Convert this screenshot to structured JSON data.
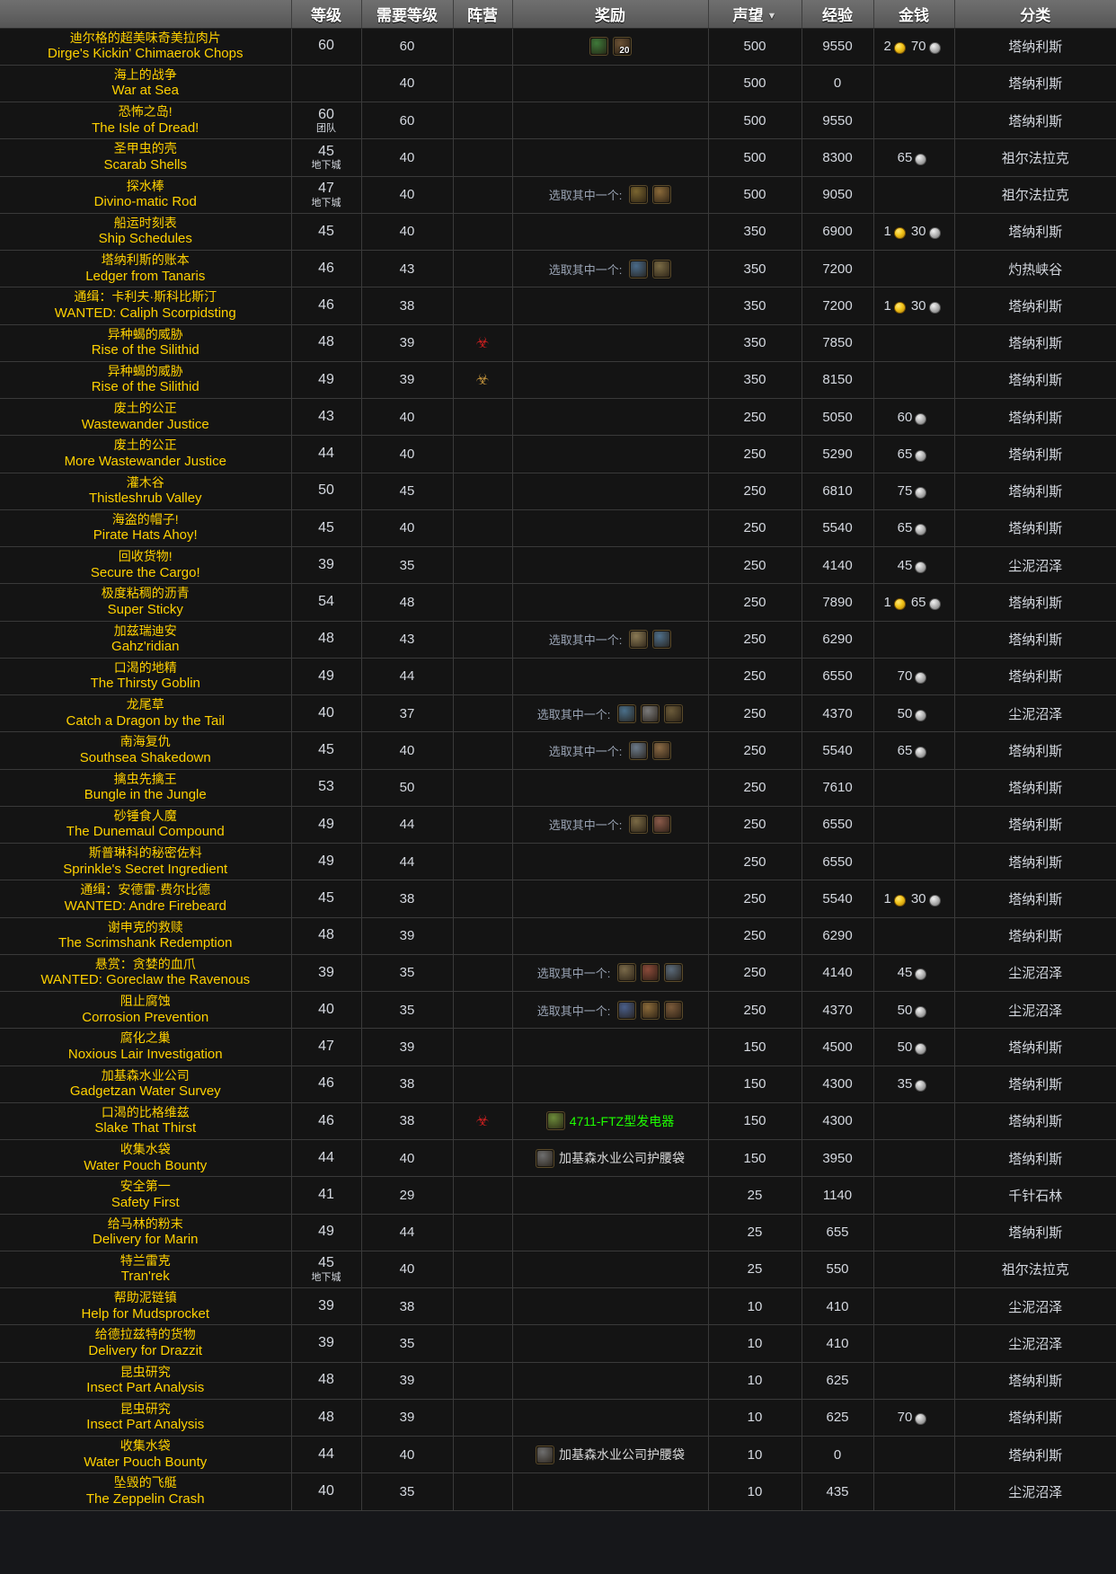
{
  "table": {
    "columns": [
      {
        "key": "name",
        "label": ""
      },
      {
        "key": "level",
        "label": "等级"
      },
      {
        "key": "req",
        "label": "需要等级"
      },
      {
        "key": "faction",
        "label": "阵营"
      },
      {
        "key": "reward",
        "label": "奖励"
      },
      {
        "key": "rep",
        "label": "声望",
        "sorted": "desc",
        "sort_icon": "▼"
      },
      {
        "key": "xp",
        "label": "经验"
      },
      {
        "key": "money",
        "label": "金钱"
      },
      {
        "key": "cat",
        "label": "分类"
      }
    ],
    "choose_one_label": "选取其中一个:",
    "level_tags": {
      "raid": "团队",
      "dungeon": "地下城"
    },
    "rows": [
      {
        "cn": "迪尔格的超美味奇美拉肉片",
        "en": "Dirge's Kickin' Chimaerok Chops",
        "level": "60",
        "level_tag": "",
        "req": "60",
        "faction": "",
        "reward_label": "",
        "reward_icons": [
          {
            "color": "#3f7a3a",
            "stack": ""
          },
          {
            "color": "#6b5235",
            "stack": "20"
          }
        ],
        "reward_text": "",
        "reward_text_color": "",
        "rep": "500",
        "xp": "9550",
        "gold": "2",
        "silver": "70",
        "cat": "塔纳利斯"
      },
      {
        "cn": "海上的战争",
        "en": "War at Sea",
        "level": "",
        "level_tag": "",
        "req": "40",
        "faction": "",
        "reward_label": "",
        "reward_icons": [],
        "reward_text": "",
        "reward_text_color": "",
        "rep": "500",
        "xp": "0",
        "gold": "",
        "silver": "",
        "cat": "塔纳利斯"
      },
      {
        "cn": "恐怖之岛!",
        "en": "The Isle of Dread!",
        "level": "60",
        "level_tag": "团队",
        "req": "60",
        "faction": "",
        "reward_label": "",
        "reward_icons": [],
        "reward_text": "",
        "reward_text_color": "",
        "rep": "500",
        "xp": "9550",
        "gold": "",
        "silver": "",
        "cat": "塔纳利斯"
      },
      {
        "cn": "圣甲虫的壳",
        "en": "Scarab Shells",
        "level": "45",
        "level_tag": "地下城",
        "req": "40",
        "faction": "",
        "reward_label": "",
        "reward_icons": [],
        "reward_text": "",
        "reward_text_color": "",
        "rep": "500",
        "xp": "8300",
        "gold": "",
        "silver": "65",
        "cat": "祖尔法拉克"
      },
      {
        "cn": "探水棒",
        "en": "Divino-matic Rod",
        "level": "47",
        "level_tag": "地下城",
        "req": "40",
        "faction": "",
        "reward_label": "选取其中一个:",
        "reward_icons": [
          {
            "color": "#7a6530",
            "stack": ""
          },
          {
            "color": "#8a6a3a",
            "stack": ""
          }
        ],
        "reward_text": "",
        "reward_text_color": "",
        "rep": "500",
        "xp": "9050",
        "gold": "",
        "silver": "",
        "cat": "祖尔法拉克"
      },
      {
        "cn": "船运时刻表",
        "en": "Ship Schedules",
        "level": "45",
        "level_tag": "",
        "req": "40",
        "faction": "",
        "reward_label": "",
        "reward_icons": [],
        "reward_text": "",
        "reward_text_color": "",
        "rep": "350",
        "xp": "6900",
        "gold": "1",
        "silver": "30",
        "cat": "塔纳利斯"
      },
      {
        "cn": "塔纳利斯的账本",
        "en": "Ledger from Tanaris",
        "level": "46",
        "level_tag": "",
        "req": "43",
        "faction": "",
        "reward_label": "选取其中一个:",
        "reward_icons": [
          {
            "color": "#4a6b8a",
            "stack": ""
          },
          {
            "color": "#7a6b45",
            "stack": ""
          }
        ],
        "reward_text": "",
        "reward_text_color": "",
        "rep": "350",
        "xp": "7200",
        "gold": "",
        "silver": "",
        "cat": "灼热峡谷"
      },
      {
        "cn": "通缉：卡利夫·斯科比斯汀",
        "en": "WANTED: Caliph Scorpidsting",
        "level": "46",
        "level_tag": "",
        "req": "38",
        "faction": "",
        "reward_label": "",
        "reward_icons": [],
        "reward_text": "",
        "reward_text_color": "",
        "rep": "350",
        "xp": "7200",
        "gold": "1",
        "silver": "30",
        "cat": "塔纳利斯"
      },
      {
        "cn": "异种蝎的威胁",
        "en": "Rise of the Silithid",
        "level": "48",
        "level_tag": "",
        "req": "39",
        "faction": "horde",
        "reward_label": "",
        "reward_icons": [],
        "reward_text": "",
        "reward_text_color": "",
        "rep": "350",
        "xp": "7850",
        "gold": "",
        "silver": "",
        "cat": "塔纳利斯"
      },
      {
        "cn": "异种蝎的威胁",
        "en": "Rise of the Silithid",
        "level": "49",
        "level_tag": "",
        "req": "39",
        "faction": "alliance",
        "reward_label": "",
        "reward_icons": [],
        "reward_text": "",
        "reward_text_color": "",
        "rep": "350",
        "xp": "8150",
        "gold": "",
        "silver": "",
        "cat": "塔纳利斯"
      },
      {
        "cn": "废土的公正",
        "en": "Wastewander Justice",
        "level": "43",
        "level_tag": "",
        "req": "40",
        "faction": "",
        "reward_label": "",
        "reward_icons": [],
        "reward_text": "",
        "reward_text_color": "",
        "rep": "250",
        "xp": "5050",
        "gold": "",
        "silver": "60",
        "cat": "塔纳利斯"
      },
      {
        "cn": "废土的公正",
        "en": "More Wastewander Justice",
        "level": "44",
        "level_tag": "",
        "req": "40",
        "faction": "",
        "reward_label": "",
        "reward_icons": [],
        "reward_text": "",
        "reward_text_color": "",
        "rep": "250",
        "xp": "5290",
        "gold": "",
        "silver": "65",
        "cat": "塔纳利斯"
      },
      {
        "cn": "灌木谷",
        "en": "Thistleshrub Valley",
        "level": "50",
        "level_tag": "",
        "req": "45",
        "faction": "",
        "reward_label": "",
        "reward_icons": [],
        "reward_text": "",
        "reward_text_color": "",
        "rep": "250",
        "xp": "6810",
        "gold": "",
        "silver": "75",
        "cat": "塔纳利斯"
      },
      {
        "cn": "海盗的帽子!",
        "en": "Pirate Hats Ahoy!",
        "level": "45",
        "level_tag": "",
        "req": "40",
        "faction": "",
        "reward_label": "",
        "reward_icons": [],
        "reward_text": "",
        "reward_text_color": "",
        "rep": "250",
        "xp": "5540",
        "gold": "",
        "silver": "65",
        "cat": "塔纳利斯"
      },
      {
        "cn": "回收货物!",
        "en": "Secure the Cargo!",
        "level": "39",
        "level_tag": "",
        "req": "35",
        "faction": "",
        "reward_label": "",
        "reward_icons": [],
        "reward_text": "",
        "reward_text_color": "",
        "rep": "250",
        "xp": "4140",
        "gold": "",
        "silver": "45",
        "cat": "尘泥沼泽"
      },
      {
        "cn": "极度粘稠的沥青",
        "en": "Super Sticky",
        "level": "54",
        "level_tag": "",
        "req": "48",
        "faction": "",
        "reward_label": "",
        "reward_icons": [],
        "reward_text": "",
        "reward_text_color": "",
        "rep": "250",
        "xp": "7890",
        "gold": "1",
        "silver": "65",
        "cat": "塔纳利斯"
      },
      {
        "cn": "加兹瑞迪安",
        "en": "Gahz'ridian",
        "level": "48",
        "level_tag": "",
        "req": "43",
        "faction": "",
        "reward_label": "选取其中一个:",
        "reward_icons": [
          {
            "color": "#8a7a55",
            "stack": ""
          },
          {
            "color": "#4f6f8a",
            "stack": ""
          }
        ],
        "reward_text": "",
        "reward_text_color": "",
        "rep": "250",
        "xp": "6290",
        "gold": "",
        "silver": "",
        "cat": "塔纳利斯"
      },
      {
        "cn": "口渴的地精",
        "en": "The Thirsty Goblin",
        "level": "49",
        "level_tag": "",
        "req": "44",
        "faction": "",
        "reward_label": "",
        "reward_icons": [],
        "reward_text": "",
        "reward_text_color": "",
        "rep": "250",
        "xp": "6550",
        "gold": "",
        "silver": "70",
        "cat": "塔纳利斯"
      },
      {
        "cn": "龙尾草",
        "en": "Catch a Dragon by the Tail",
        "level": "40",
        "level_tag": "",
        "req": "37",
        "faction": "",
        "reward_label": "选取其中一个:",
        "reward_icons": [
          {
            "color": "#4a6f8a",
            "stack": ""
          },
          {
            "color": "#7a7a7a",
            "stack": ""
          },
          {
            "color": "#6b5b3a",
            "stack": ""
          }
        ],
        "reward_text": "",
        "reward_text_color": "",
        "rep": "250",
        "xp": "4370",
        "gold": "",
        "silver": "50",
        "cat": "尘泥沼泽"
      },
      {
        "cn": "南海复仇",
        "en": "Southsea Shakedown",
        "level": "45",
        "level_tag": "",
        "req": "40",
        "faction": "",
        "reward_label": "选取其中一个:",
        "reward_icons": [
          {
            "color": "#6b7a8a",
            "stack": ""
          },
          {
            "color": "#8a6a45",
            "stack": ""
          }
        ],
        "reward_text": "",
        "reward_text_color": "",
        "rep": "250",
        "xp": "5540",
        "gold": "",
        "silver": "65",
        "cat": "塔纳利斯"
      },
      {
        "cn": "擒虫先擒王",
        "en": "Bungle in the Jungle",
        "level": "53",
        "level_tag": "",
        "req": "50",
        "faction": "",
        "reward_label": "",
        "reward_icons": [],
        "reward_text": "",
        "reward_text_color": "",
        "rep": "250",
        "xp": "7610",
        "gold": "",
        "silver": "",
        "cat": "塔纳利斯"
      },
      {
        "cn": "砂锤食人魔",
        "en": "The Dunemaul Compound",
        "level": "49",
        "level_tag": "",
        "req": "44",
        "faction": "",
        "reward_label": "选取其中一个:",
        "reward_icons": [
          {
            "color": "#7a6a45",
            "stack": ""
          },
          {
            "color": "#8a5a4a",
            "stack": ""
          }
        ],
        "reward_text": "",
        "reward_text_color": "",
        "rep": "250",
        "xp": "6550",
        "gold": "",
        "silver": "",
        "cat": "塔纳利斯"
      },
      {
        "cn": "斯普琳科的秘密佐料",
        "en": "Sprinkle's Secret Ingredient",
        "level": "49",
        "level_tag": "",
        "req": "44",
        "faction": "",
        "reward_label": "",
        "reward_icons": [],
        "reward_text": "",
        "reward_text_color": "",
        "rep": "250",
        "xp": "6550",
        "gold": "",
        "silver": "",
        "cat": "塔纳利斯"
      },
      {
        "cn": "通缉：安德雷·费尔比德",
        "en": "WANTED: Andre Firebeard",
        "level": "45",
        "level_tag": "",
        "req": "38",
        "faction": "",
        "reward_label": "",
        "reward_icons": [],
        "reward_text": "",
        "reward_text_color": "",
        "rep": "250",
        "xp": "5540",
        "gold": "1",
        "silver": "30",
        "cat": "塔纳利斯"
      },
      {
        "cn": "谢申克的救赎",
        "en": "The Scrimshank Redemption",
        "level": "48",
        "level_tag": "",
        "req": "39",
        "faction": "",
        "reward_label": "",
        "reward_icons": [],
        "reward_text": "",
        "reward_text_color": "",
        "rep": "250",
        "xp": "6290",
        "gold": "",
        "silver": "",
        "cat": "塔纳利斯"
      },
      {
        "cn": "悬赏：贪婪的血爪",
        "en": "WANTED: Goreclaw the Ravenous",
        "level": "39",
        "level_tag": "",
        "req": "35",
        "faction": "",
        "reward_label": "选取其中一个:",
        "reward_icons": [
          {
            "color": "#7a6a4a",
            "stack": ""
          },
          {
            "color": "#8a4a3a",
            "stack": ""
          },
          {
            "color": "#5a6a7a",
            "stack": ""
          }
        ],
        "reward_text": "",
        "reward_text_color": "",
        "rep": "250",
        "xp": "4140",
        "gold": "",
        "silver": "45",
        "cat": "尘泥沼泽"
      },
      {
        "cn": "阻止腐蚀",
        "en": "Corrosion Prevention",
        "level": "40",
        "level_tag": "",
        "req": "35",
        "faction": "",
        "reward_label": "选取其中一个:",
        "reward_icons": [
          {
            "color": "#4a5f8a",
            "stack": ""
          },
          {
            "color": "#8a6a3a",
            "stack": ""
          },
          {
            "color": "#7a5a3a",
            "stack": ""
          }
        ],
        "reward_text": "",
        "reward_text_color": "",
        "rep": "250",
        "xp": "4370",
        "gold": "",
        "silver": "50",
        "cat": "尘泥沼泽"
      },
      {
        "cn": "腐化之巢",
        "en": "Noxious Lair Investigation",
        "level": "47",
        "level_tag": "",
        "req": "39",
        "faction": "",
        "reward_label": "",
        "reward_icons": [],
        "reward_text": "",
        "reward_text_color": "",
        "rep": "150",
        "xp": "4500",
        "gold": "",
        "silver": "50",
        "cat": "塔纳利斯"
      },
      {
        "cn": "加基森水业公司",
        "en": "Gadgetzan Water Survey",
        "level": "46",
        "level_tag": "",
        "req": "38",
        "faction": "",
        "reward_label": "",
        "reward_icons": [],
        "reward_text": "",
        "reward_text_color": "",
        "rep": "150",
        "xp": "4300",
        "gold": "",
        "silver": "35",
        "cat": "塔纳利斯"
      },
      {
        "cn": "口渴的比格维兹",
        "en": "Slake That Thirst",
        "level": "46",
        "level_tag": "",
        "req": "38",
        "faction": "horde",
        "reward_label": "",
        "reward_icons": [
          {
            "color": "#6b8a3a",
            "stack": ""
          }
        ],
        "reward_text": "4711-FTZ型发电器",
        "reward_text_color": "green",
        "rep": "150",
        "xp": "4300",
        "gold": "",
        "silver": "",
        "cat": "塔纳利斯"
      },
      {
        "cn": "收集水袋",
        "en": "Water Pouch Bounty",
        "level": "44",
        "level_tag": "",
        "req": "40",
        "faction": "",
        "reward_label": "",
        "reward_icons": [
          {
            "color": "#6f6f6f",
            "stack": ""
          }
        ],
        "reward_text": "加基森水业公司护腰袋",
        "reward_text_color": "white",
        "rep": "150",
        "xp": "3950",
        "gold": "",
        "silver": "",
        "cat": "塔纳利斯"
      },
      {
        "cn": "安全第一",
        "en": "Safety First",
        "level": "41",
        "level_tag": "",
        "req": "29",
        "faction": "",
        "reward_label": "",
        "reward_icons": [],
        "reward_text": "",
        "reward_text_color": "",
        "rep": "25",
        "xp": "1140",
        "gold": "",
        "silver": "",
        "cat": "千针石林"
      },
      {
        "cn": "给马林的粉末",
        "en": "Delivery for Marin",
        "level": "49",
        "level_tag": "",
        "req": "44",
        "faction": "",
        "reward_label": "",
        "reward_icons": [],
        "reward_text": "",
        "reward_text_color": "",
        "rep": "25",
        "xp": "655",
        "gold": "",
        "silver": "",
        "cat": "塔纳利斯"
      },
      {
        "cn": "特兰雷克",
        "en": "Tran'rek",
        "level": "45",
        "level_tag": "地下城",
        "req": "40",
        "faction": "",
        "reward_label": "",
        "reward_icons": [],
        "reward_text": "",
        "reward_text_color": "",
        "rep": "25",
        "xp": "550",
        "gold": "",
        "silver": "",
        "cat": "祖尔法拉克"
      },
      {
        "cn": "帮助泥链镇",
        "en": "Help for Mudsprocket",
        "level": "39",
        "level_tag": "",
        "req": "38",
        "faction": "",
        "reward_label": "",
        "reward_icons": [],
        "reward_text": "",
        "reward_text_color": "",
        "rep": "10",
        "xp": "410",
        "gold": "",
        "silver": "",
        "cat": "尘泥沼泽"
      },
      {
        "cn": "给德拉兹特的货物",
        "en": "Delivery for Drazzit",
        "level": "39",
        "level_tag": "",
        "req": "35",
        "faction": "",
        "reward_label": "",
        "reward_icons": [],
        "reward_text": "",
        "reward_text_color": "",
        "rep": "10",
        "xp": "410",
        "gold": "",
        "silver": "",
        "cat": "尘泥沼泽"
      },
      {
        "cn": "昆虫研究",
        "en": "Insect Part Analysis",
        "level": "48",
        "level_tag": "",
        "req": "39",
        "faction": "",
        "reward_label": "",
        "reward_icons": [],
        "reward_text": "",
        "reward_text_color": "",
        "rep": "10",
        "xp": "625",
        "gold": "",
        "silver": "",
        "cat": "塔纳利斯"
      },
      {
        "cn": "昆虫研究",
        "en": "Insect Part Analysis",
        "level": "48",
        "level_tag": "",
        "req": "39",
        "faction": "",
        "reward_label": "",
        "reward_icons": [],
        "reward_text": "",
        "reward_text_color": "",
        "rep": "10",
        "xp": "625",
        "gold": "",
        "silver": "70",
        "cat": "塔纳利斯"
      },
      {
        "cn": "收集水袋",
        "en": "Water Pouch Bounty",
        "level": "44",
        "level_tag": "",
        "req": "40",
        "faction": "",
        "reward_label": "",
        "reward_icons": [
          {
            "color": "#6f6f6f",
            "stack": ""
          }
        ],
        "reward_text": "加基森水业公司护腰袋",
        "reward_text_color": "white",
        "rep": "10",
        "xp": "0",
        "gold": "",
        "silver": "",
        "cat": "塔纳利斯"
      },
      {
        "cn": "坠毁的飞艇",
        "en": "The Zeppelin Crash",
        "level": "40",
        "level_tag": "",
        "req": "35",
        "faction": "",
        "reward_label": "",
        "reward_icons": [],
        "reward_text": "",
        "reward_text_color": "",
        "rep": "10",
        "xp": "435",
        "gold": "",
        "silver": "",
        "cat": "尘泥沼泽"
      }
    ]
  }
}
